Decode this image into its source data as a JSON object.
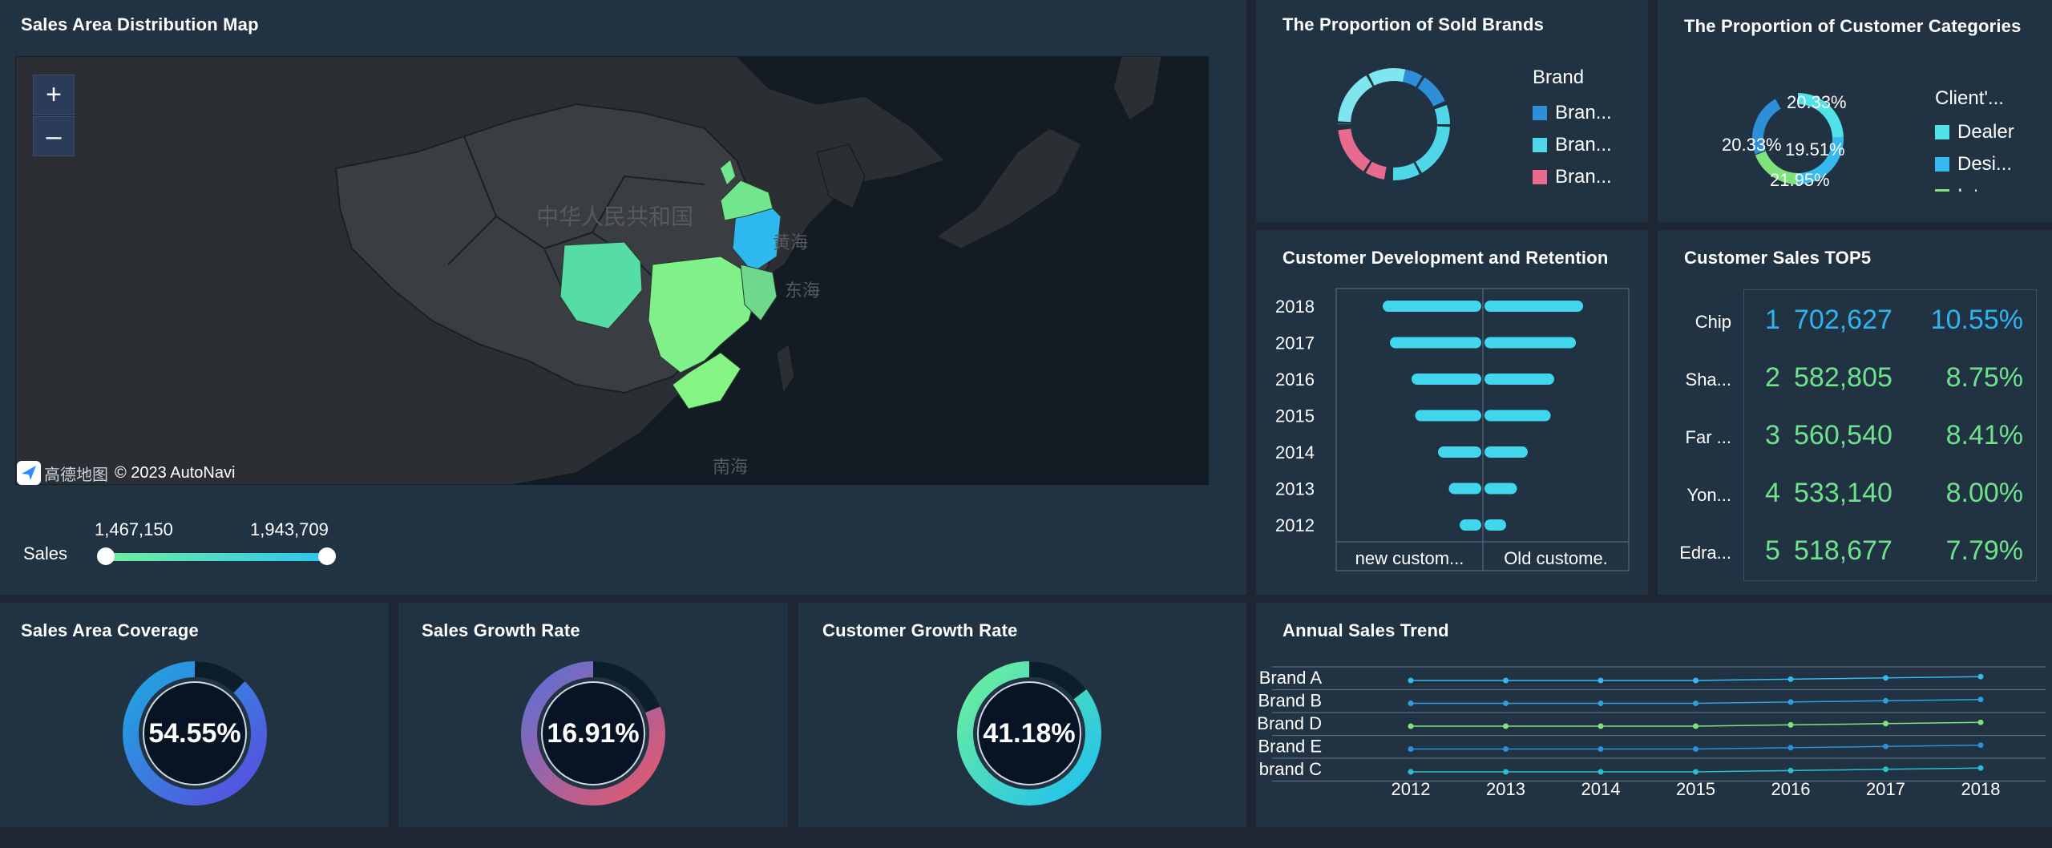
{
  "map": {
    "title": "Sales Area Distribution Map",
    "zoom_in": "+",
    "zoom_out": "–",
    "labels": {
      "china": "中华人民共和国",
      "yellow_sea": "黄海",
      "east_sea": "东海",
      "south_sea": "南海"
    },
    "attribution": "© 2023 AutoNavi",
    "logo_text": "高德地图",
    "slider": {
      "label": "Sales",
      "min": "1,467,150",
      "max": "1,943,709"
    }
  },
  "brands": {
    "title": "The Proportion of Sold Brands",
    "legend_title": "Brand",
    "items": [
      {
        "label": "Bran...",
        "color": "#2d8fd8"
      },
      {
        "label": "Bran...",
        "color": "#4fd6e8"
      },
      {
        "label": "Bran...",
        "color": "#e86a8e"
      }
    ]
  },
  "customer_categories": {
    "title": "The Proportion of Customer Categories",
    "legend_title": "Client'...",
    "labels": [
      "20.33%",
      "20.33%",
      "19.51%",
      "21.95%"
    ],
    "items": [
      {
        "label": "Dealer",
        "color": "#4fe3e8"
      },
      {
        "label": "Desi...",
        "color": "#35b9f0"
      },
      {
        "label": "Inter...",
        "color": "#7fe27a"
      }
    ]
  },
  "retention": {
    "title": "Customer Development and Retention",
    "years": [
      "2018",
      "2017",
      "2016",
      "2015",
      "2014",
      "2013",
      "2012"
    ],
    "new_values": [
      0.82,
      0.76,
      0.58,
      0.55,
      0.36,
      0.27,
      0.18
    ],
    "old_values": [
      0.82,
      0.76,
      0.58,
      0.55,
      0.36,
      0.27,
      0.18
    ],
    "x_labels": [
      "new custom...",
      "Old custome."
    ]
  },
  "top5": {
    "title": "Customer Sales TOP5",
    "rows": [
      {
        "name": "Chip",
        "rank": "1",
        "value": "702,627",
        "pct": "10.55%",
        "color": "#2fb4f0"
      },
      {
        "name": "Sha...",
        "rank": "2",
        "value": "582,805",
        "pct": "8.75%",
        "color": "#6ee28a"
      },
      {
        "name": "Far ...",
        "rank": "3",
        "value": "560,540",
        "pct": "8.41%",
        "color": "#6ee28a"
      },
      {
        "name": "Yon...",
        "rank": "4",
        "value": "533,140",
        "pct": "8.00%",
        "color": "#6ee28a"
      },
      {
        "name": "Edra...",
        "rank": "5",
        "value": "518,677",
        "pct": "7.79%",
        "color": "#6ee28a"
      }
    ]
  },
  "kpis": [
    {
      "title": "Sales Area Coverage",
      "value": "54.55%",
      "fraction": 0.5455
    },
    {
      "title": "Sales Growth Rate",
      "value": "16.91%",
      "fraction": 0.1691
    },
    {
      "title": "Customer Growth Rate",
      "value": "41.18%",
      "fraction": 0.4118
    }
  ],
  "trend": {
    "title": "Annual Sales Trend",
    "rows": [
      "Brand A",
      "Brand B",
      "Brand D",
      "Brand E",
      "brand C"
    ],
    "years": [
      "2012",
      "2013",
      "2014",
      "2015",
      "2016",
      "2017",
      "2018"
    ],
    "colors": [
      "#35b9f0",
      "#2f9fe0",
      "#7fe27a",
      "#2d8fd8",
      "#26c0d0"
    ]
  }
}
